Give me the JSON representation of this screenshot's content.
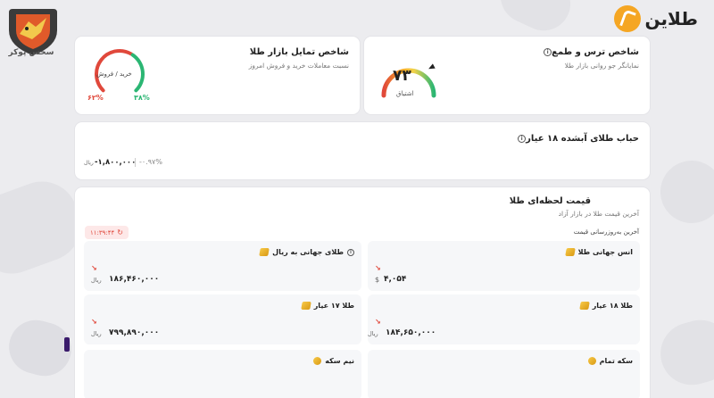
{
  "watermark": {
    "text": "سحس پوکر"
  },
  "brand": {
    "name": "طلاین"
  },
  "fear_greed": {
    "title": "شاخص ترس و طمع",
    "subtitle": "نمایانگر جو روانی بازار طلا",
    "value": "۷۳",
    "value_numeric": 73,
    "state": "اشتیاق"
  },
  "sentiment": {
    "title": "شاخص تمایل بازار طلا",
    "subtitle": "نسبت معاملات خرید و فروش امروز",
    "center_label": "خرید / فروش",
    "buy_pct": "۳۸%",
    "sell_pct": "۶۲%",
    "buy_fraction": 0.38,
    "sell_fraction": 0.62,
    "buy_color": "#2bb673",
    "sell_color": "#e0483b"
  },
  "bubble": {
    "title": "حباب طلای آبشده ۱۸ عیار",
    "value": "-۱,۸۰۰,۰۰۰",
    "unit": "ریال",
    "percent": "-۰.۹۷%"
  },
  "live": {
    "title": "قیمت لحظه‌ای طلا",
    "subtitle": "آخرین قیمت طلا در بازار آزاد",
    "update_label": "آخرین به‌روزرسانی قیمت",
    "update_time": "۱۱:۳۹:۴۴",
    "items": [
      {
        "title": "انس جهانی طلا",
        "value": "۴,۰۵۴",
        "unit": "$",
        "arrow": "↘"
      },
      {
        "title": "طلای جهانی به ریال",
        "value": "۱۸۶,۴۶۰,۰۰۰",
        "unit": "ریال",
        "arrow": "↘"
      },
      {
        "title": "طلا ۱۸ عیار",
        "value": "۱۸۴,۶۵۰,۰۰۰",
        "unit": "ریال",
        "arrow": "↘"
      },
      {
        "title": "طلا ۱۷ عیار",
        "value": "۷۹۹,۸۹۰,۰۰۰",
        "unit": "ریال",
        "arrow": "↘"
      },
      {
        "title": "سکه تمام",
        "value": "",
        "unit": "",
        "arrow": ""
      },
      {
        "title": "نیم سکه",
        "value": "",
        "unit": "",
        "arrow": ""
      }
    ]
  }
}
